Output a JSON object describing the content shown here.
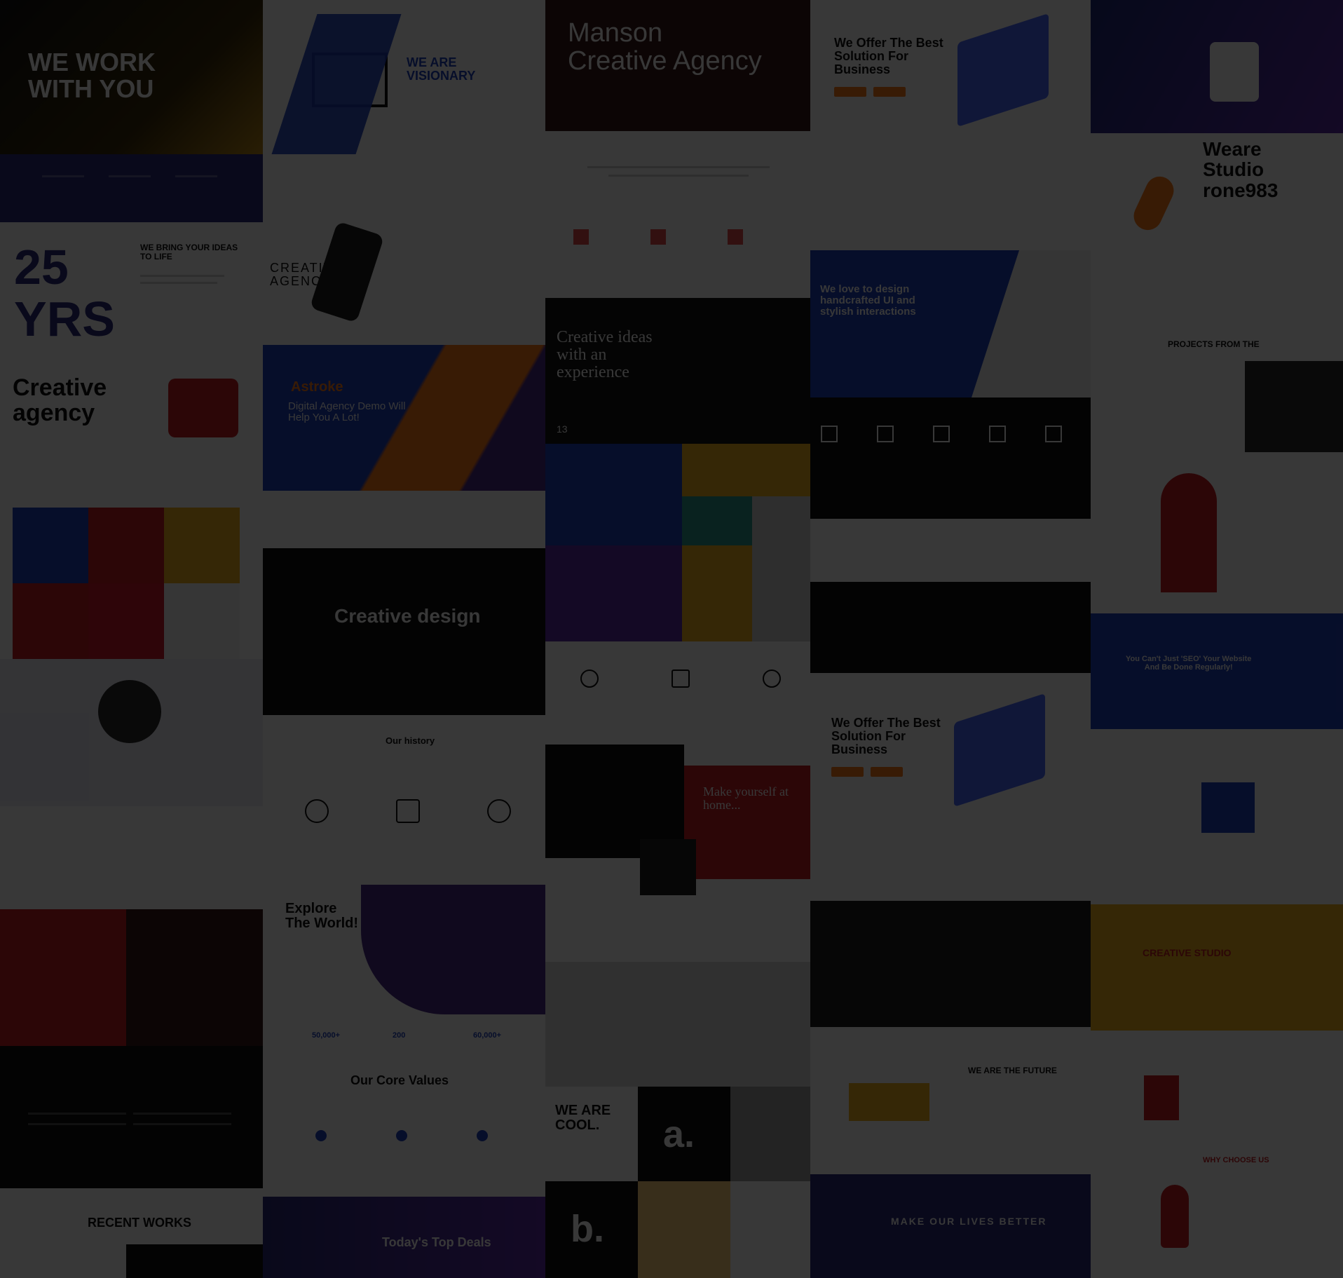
{
  "colors": {
    "overlay": "#000000",
    "yellow": "#f2b01e",
    "navy": "#2b2a7a",
    "blue": "#1f3fbf",
    "red": "#c61b22",
    "purple": "#5b2aa8",
    "orange": "#ff7a1a",
    "white": "#ffffff",
    "black": "#0e0e10"
  },
  "tiles": [
    {
      "id": "t1",
      "label": "WE WORK\nWITH YOU",
      "icon": "agency-hero"
    },
    {
      "id": "t2",
      "label": "WE ARE\nVISIONARY",
      "icon": "laptop-illustration"
    },
    {
      "id": "t3",
      "label": "Manson\nCreative Agency",
      "icon": "triangle-logo-icon"
    },
    {
      "id": "t4",
      "label": "We Offer The Best\nSolution For\nBusiness",
      "icon": "isometric-dashboard"
    },
    {
      "id": "t5",
      "label": "Weare\nStudio\nrone983",
      "icon": "astronaut-illustration"
    },
    {
      "id": "t6",
      "label": "WE BRING YOUR IDEAS\nTO LIFE",
      "icon": "25-yrs-graphic"
    },
    {
      "id": "t7",
      "label": "CREATIVE\nAGENCY",
      "icon": "phone-illustration"
    },
    {
      "id": "t8",
      "label": "Creative ideas\nwith an\nexperience",
      "icon": "dark-hero"
    },
    {
      "id": "t9",
      "label": "We love to design\nhandcrafted UI and\nstylish interactions",
      "icon": "blue-hero"
    },
    {
      "id": "t10",
      "label": "PROJECTS FROM THE",
      "icon": "portfolio-grid"
    },
    {
      "id": "t11",
      "label": "Creative\nagency",
      "icon": "thumbs-up-icon"
    },
    {
      "id": "t12",
      "label": "Astroke",
      "sub": "Digital Agency Demo Will\nHelp You A Lot!",
      "icon": "astroke-hero"
    },
    {
      "id": "t13",
      "label": "Creative design",
      "sub": "Our history",
      "icon": "creative-design-hero"
    },
    {
      "id": "t14",
      "label": "Make yourself at\nhome...",
      "icon": "red-block"
    },
    {
      "id": "t15",
      "label": "We Offer The Best\nSolution For\nBusiness",
      "icon": "isometric-dashboard"
    },
    {
      "id": "t16",
      "label": "You Can't Just 'SEO' Your Website\nAnd Be Done Regularly!",
      "icon": "seo-hero"
    },
    {
      "id": "t17",
      "label": "Explore\nThe World!",
      "icon": "travel-illustration"
    },
    {
      "id": "t18",
      "label": "Our Core Values",
      "icon": "core-values"
    },
    {
      "id": "t19",
      "label": "WE ARE\nCOOL.",
      "icon": "cool-block"
    },
    {
      "id": "t20",
      "label": "CREATIVE STUDIO",
      "icon": "yellow-workspace"
    },
    {
      "id": "t21",
      "label": "WE ARE THE FUTURE",
      "icon": "future-block"
    },
    {
      "id": "t22",
      "label": "MAKE OUR LIVES BETTER",
      "icon": "dark-banner"
    },
    {
      "id": "t23",
      "label": "RECENT WORKS",
      "icon": "recent-works"
    },
    {
      "id": "t24",
      "label": "Today's Top Deals",
      "icon": "deals-banner"
    },
    {
      "id": "t25",
      "label": "WHY CHOOSE US",
      "icon": "superhero-illustration"
    }
  ],
  "stats": [
    "50,000+",
    "200",
    "60,000+"
  ],
  "letters": [
    "a.",
    "b."
  ],
  "numbers": [
    "13"
  ]
}
